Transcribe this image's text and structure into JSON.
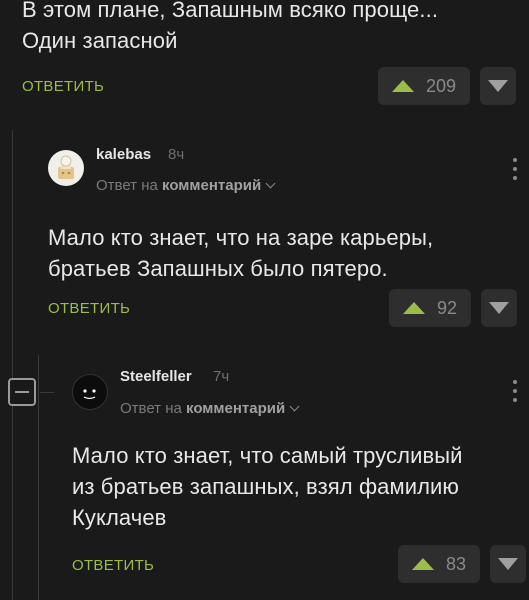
{
  "comments": [
    {
      "text_line1": "В этом плане, Запашным всяко проще...",
      "text_line2": "Один запасной",
      "reply_label": "ОТВЕТИТЬ",
      "votes": "209"
    },
    {
      "username": "kalebas",
      "time": "8ч",
      "reply_to_prefix": "Ответ на",
      "reply_to_link": "комментарий",
      "text_line1": "Мало кто знает, что на заре карьеры,",
      "text_line2": "братьев Запашных было пятеро.",
      "reply_label": "ОТВЕТИТЬ",
      "votes": "92"
    },
    {
      "username": "Steelfeller",
      "time": "7ч",
      "reply_to_prefix": "Ответ на",
      "reply_to_link": "комментарий",
      "text_line1": "Мало кто знает, что самый трусливый",
      "text_line2": "из братьев запашных, взял фамилию",
      "text_line3": "Куклачев",
      "reply_label": "ОТВЕТИТЬ",
      "votes": "83"
    }
  ],
  "icons": {
    "upvote": "triangle-up-icon",
    "downvote": "triangle-down-icon",
    "more": "kebab-menu-icon",
    "collapse": "minus-square-icon"
  },
  "colors": {
    "background": "#1a1a1a",
    "accent_green": "#9bbd4a",
    "button_bg": "#2e2e2e",
    "text": "#e8e8e8",
    "muted": "#7a7a7a"
  }
}
